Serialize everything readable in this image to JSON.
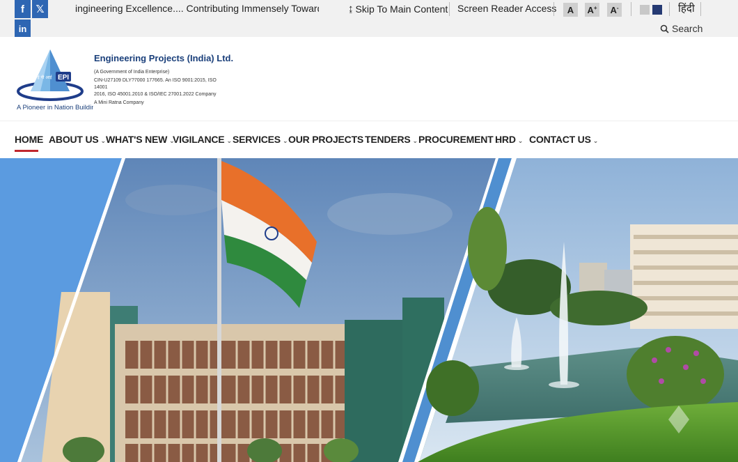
{
  "social": {
    "facebook": "f",
    "x": "𝕏",
    "linkedin": "in"
  },
  "marquee_text": "ingineering Excellence.... Contributing Immensely Towards Gr",
  "accessibility": {
    "skip_label": "Skip To Main Content",
    "screen_reader_label": "Screen Reader Access",
    "font_decrease": "A",
    "font_normal": "A",
    "font_increase": "A",
    "font_plus_sup": "+",
    "font_minus_sup": "-",
    "theme_light_color": "#c8c8c8",
    "theme_dark_color": "#253a73",
    "language": "हिंदी",
    "search_label": "Search"
  },
  "org": {
    "logo_text": "EPI",
    "logo_script": "ई पी आई",
    "tagline": "A Pioneer in Nation Building",
    "name": "Engineering Projects (India) Ltd.",
    "line1": "(A Government of India Enterprise)",
    "line2": "CIN-U27109 DLY?7000 177665. An ISO 9001:2015, ISO 14001",
    "line3": "2016,  ISO  45001.2010  &  ISO/IEC  27001.2022  Company",
    "line4": "A Mini Ratna Company"
  },
  "nav": {
    "items": [
      {
        "label": "HOME",
        "active": true,
        "dropdown": false
      },
      {
        "label": "ABOUT US",
        "active": false,
        "dropdown": true
      },
      {
        "label": "WHAT'S NEW",
        "active": false,
        "dropdown": true
      },
      {
        "label": "VIGILANCE",
        "active": false,
        "dropdown": true
      },
      {
        "label": "SERVICES",
        "active": false,
        "dropdown": true
      },
      {
        "label": "OUR PROJECTS",
        "active": false,
        "dropdown": true
      },
      {
        "label": "TENDERS",
        "active": false,
        "dropdown": true
      },
      {
        "label": "PROCUREMENT",
        "active": false,
        "dropdown": true
      },
      {
        "label": "HRD",
        "active": false,
        "dropdown": true
      },
      {
        "label": "CONTACT US",
        "active": false,
        "dropdown": true
      }
    ],
    "active_color": "#c0272d"
  },
  "hero": {
    "icons": [
      "flag-icon",
      "building-icon",
      "fountain-icon"
    ],
    "accent": "#5b97d6"
  }
}
